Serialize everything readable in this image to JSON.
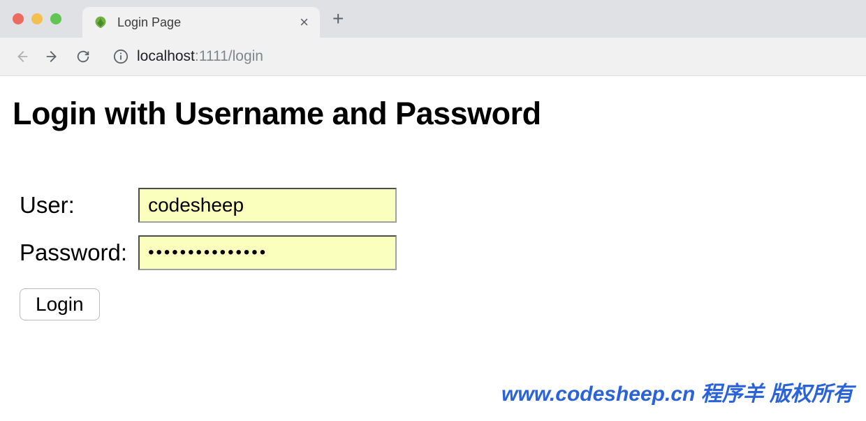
{
  "browser": {
    "tab": {
      "title": "Login Page",
      "favicon": "spring-leaf-icon"
    },
    "url": {
      "host": "localhost",
      "path": ":1111/login"
    }
  },
  "page": {
    "heading": "Login with Username and Password",
    "form": {
      "user_label": "User:",
      "user_value": "codesheep",
      "password_label": "Password:",
      "password_value": "•••••••••••••••",
      "submit_label": "Login"
    }
  },
  "watermark": "www.codesheep.cn 程序羊  版权所有"
}
